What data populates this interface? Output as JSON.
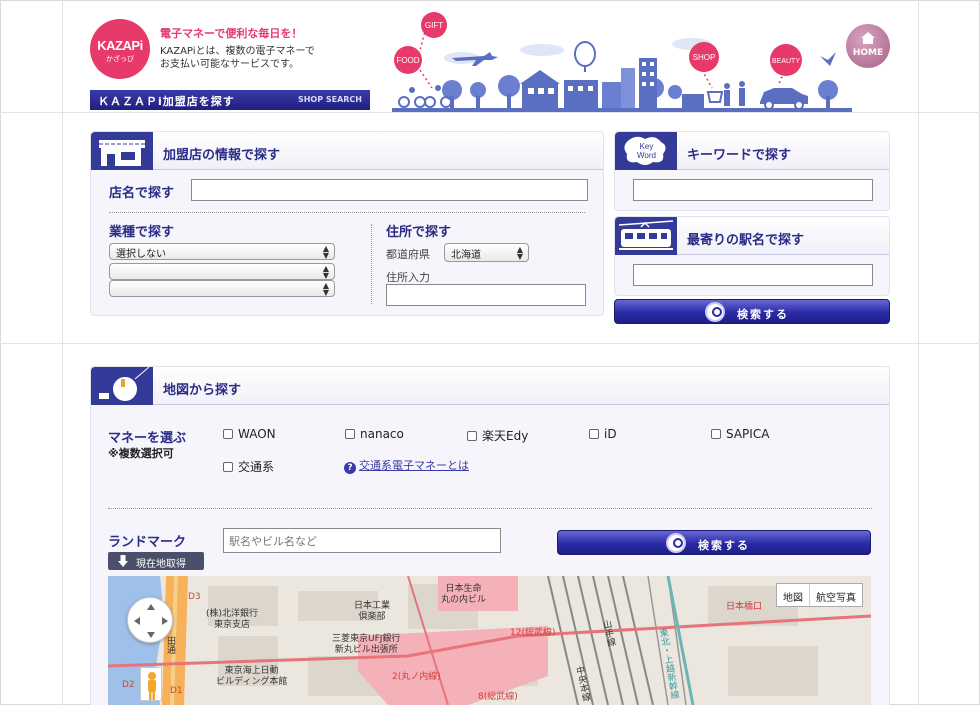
{
  "header": {
    "logo_text": "KAZAPi",
    "logo_sub": "かざっぴ",
    "catchphrase": "電子マネーで便利な毎日を！",
    "intro_line1": "KAZAPiとは、複数の電子マネーで",
    "intro_line2": "お支払い可能なサービスです。",
    "shopbar_title": "ＫＡＺＡＰi加盟店を探す",
    "shopbar_sub": "SHOP SEARCH",
    "bubbles": [
      "GIFT",
      "FOOD",
      "SHOP",
      "BEAUTY"
    ],
    "home_label": "HOME"
  },
  "info_panel": {
    "title": "加盟店の情報で探す",
    "store_name_label": "店名で探す",
    "store_name_value": "",
    "category_label": "業種で探す",
    "category_selects": [
      "選択しない",
      "",
      ""
    ],
    "address_label": "住所で探す",
    "prefecture_label": "都道府県",
    "prefecture_value": "北海道",
    "address_input_label": "住所入力",
    "address_input_value": ""
  },
  "keyword_panel": {
    "icon_text_1": "Key",
    "icon_text_2": "Word",
    "title": "キーワードで探す",
    "value": ""
  },
  "station_panel": {
    "title": "最寄りの駅名で探す",
    "value": ""
  },
  "search_button_label": "検索する",
  "map_panel": {
    "title": "地図から探す",
    "money_label": "マネーを選ぶ",
    "money_note": "※複数選択可",
    "money_options": [
      "WAON",
      "nanaco",
      "楽天Edy",
      "iD",
      "SAPICA",
      "交通系"
    ],
    "transit_help_link": "交通系電子マネーとは",
    "landmark_label": "ランドマーク",
    "landmark_placeholder": "駅名やビル名など",
    "search_button_label": "検索する",
    "current_location_label": "現在地取得",
    "map_type_options": [
      "地図",
      "航空写真"
    ],
    "map_labels": {
      "bank_name": "(株)北洋銀行",
      "bank_branch": "東京支店",
      "seimei_1": "日本生命",
      "seimei_2": "丸の内ビル",
      "kogyo_1": "日本工業",
      "kogyo_2": "倶楽部",
      "ufj_1": "三菱東京UFJ銀行",
      "ufj_2": "新丸ビル出張所",
      "kaijo_1": "東京海上日動",
      "kaijo_2": "ビルディング本館",
      "line_yamanote": "山手線",
      "line_sobu_1": "12(総武線)",
      "line_marunouchi": "2(丸ノ内線)",
      "line_sobu_2": "8(総武線)",
      "line_chuo": "中央本線",
      "line_tohoku": "東北・上越新幹線",
      "nihonbashi": "日本橋口",
      "exit_d3": "D3",
      "exit_d2": "D2",
      "exit_d1": "D1",
      "dori": "田通"
    }
  },
  "colors": {
    "brand_pink": "#e8396b",
    "navy": "#2b2b88",
    "button_blue": "#2a2aa6"
  }
}
